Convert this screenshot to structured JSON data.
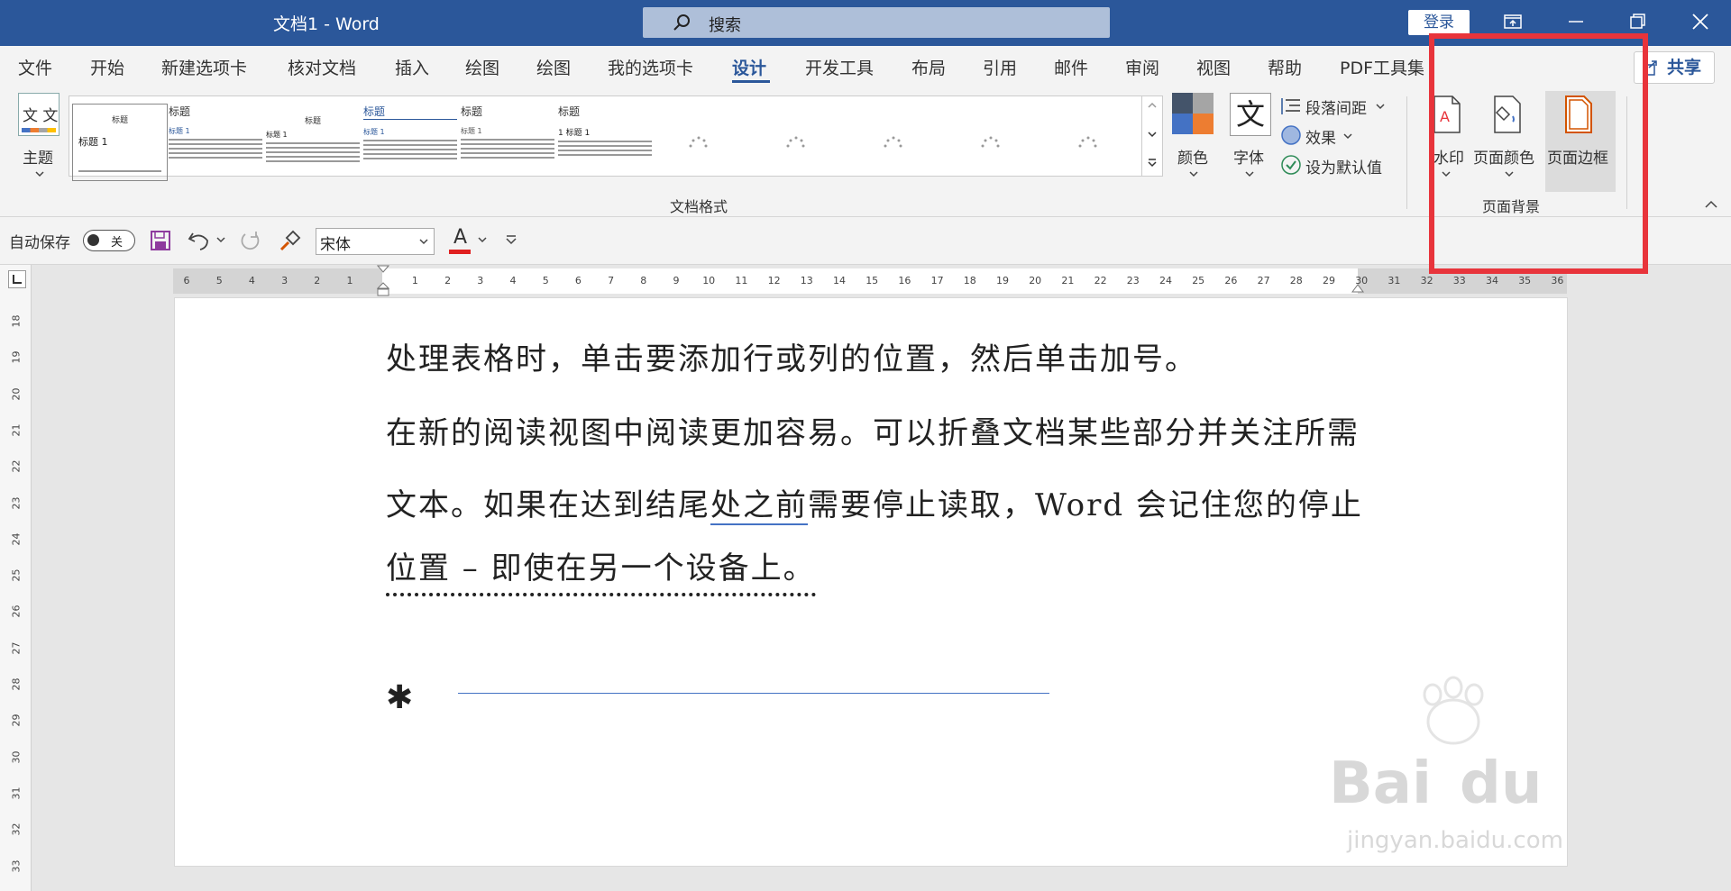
{
  "titlebar": {
    "doc_title": "文档1  -  Word",
    "search_placeholder": "搜索",
    "login": "登录"
  },
  "tabs": [
    "文件",
    "开始",
    "新建选项卡",
    "核对文档",
    "插入",
    "绘图",
    "绘图",
    "我的选项卡",
    "设计",
    "开发工具",
    "布局",
    "引用",
    "邮件",
    "审阅",
    "视图",
    "帮助",
    "PDF工具集"
  ],
  "active_tab": "设计",
  "share_label": "共享",
  "ribbon": {
    "theme_label": "主题",
    "theme_icon_text": "文 文",
    "gallery": [
      {
        "title": "标题",
        "heading": "标题 1"
      },
      {
        "title": "标题",
        "heading": "标题 1"
      },
      {
        "title": "标题",
        "heading": "标题 1"
      },
      {
        "title": "标题",
        "heading": "标题 1"
      },
      {
        "title": "标题",
        "heading": "标题 1"
      },
      {
        "title": "标题",
        "heading": "1  标题 1"
      }
    ],
    "colors_label": "颜色",
    "fonts_label": "字体",
    "fonts_icon": "文",
    "paragraph_spacing": "段落间距",
    "effects": "效果",
    "set_default": "设为默认值",
    "doc_format_group": "文档格式",
    "watermark": "水印",
    "page_color": "页面颜色",
    "page_border": "页面边框",
    "page_bg_group": "页面背景"
  },
  "qat": {
    "autosave_label": "自动保存",
    "autosave_state": "关",
    "font_name": "宋体",
    "font_color_letter": "A"
  },
  "hruler_ticks": [
    "6",
    "5",
    "4",
    "3",
    "2",
    "1",
    "",
    "1",
    "2",
    "3",
    "4",
    "5",
    "6",
    "7",
    "8",
    "9",
    "10",
    "11",
    "12",
    "13",
    "14",
    "15",
    "16",
    "17",
    "18",
    "19",
    "20",
    "21",
    "22",
    "23",
    "24",
    "25",
    "26",
    "27",
    "28",
    "29",
    "30",
    "31",
    "32",
    "33",
    "34",
    "35",
    "36"
  ],
  "vruler_ticks": [
    "18",
    "19",
    "20",
    "21",
    "22",
    "23",
    "24",
    "25",
    "26",
    "27",
    "28",
    "29",
    "30",
    "31",
    "32",
    "33"
  ],
  "document": {
    "line1": "处理表格时，单击要添加行或列的位置，然后单击加号。",
    "line2": "在新的阅读视图中阅读更加容易。可以折叠文档某些部分并关注所需",
    "line3a": "文本。如果在达到结尾",
    "line3b": "处之前",
    "line3c": "需要停止读取，Word  会记住您的停止",
    "line4": "位置  –  即使在另一个设备上。",
    "bullet": "✱"
  },
  "colors": {
    "titlebar": "#2b579a",
    "highlight": "#e8343b",
    "page_border_icon": "#d35400"
  }
}
